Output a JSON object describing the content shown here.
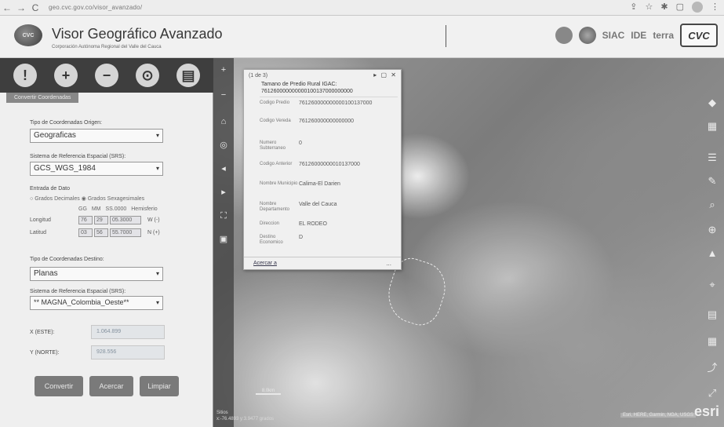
{
  "browser": {
    "back_icon": "←",
    "forward_icon": "→",
    "reload_icon": "C",
    "url": "geo.cvc.gov.co/visor_avanzado/"
  },
  "header": {
    "title": "Visor Geográfico Avanzado",
    "subtitle": "Corporación Autónoma Regional del Valle del Cauca",
    "logos": {
      "siac": "SIAC",
      "ide": "IDE",
      "terra": "terra",
      "cvc": "CVC"
    }
  },
  "toolbar": {
    "tools": [
      "info-icon",
      "plus-icon",
      "minus-icon",
      "location-pin-icon",
      "document-icon"
    ]
  },
  "panel": {
    "tab_label": "Convertir Coordenadas",
    "origin_type_label": "Tipo de Coordenadas Origen:",
    "origin_type_value": "Geograficas",
    "origin_srs_label": "Sistema de Referencia Espacial (SRS):",
    "origin_srs_value": "GCS_WGS_1984",
    "entry_label": "Entrada de Dato",
    "radio_decimal": "Grados Decimales",
    "radio_sexagesimal": "Grados Sexagesimales",
    "coord_header": "GG MM SS.0000 Hemisferio",
    "longitude": {
      "label": "Longitud",
      "gg": "76",
      "mm": "29",
      "ss": "05.3000",
      "hemisphere": "W (-)"
    },
    "latitude": {
      "label": "Latitud",
      "gg": "03",
      "mm": "56",
      "ss": "55.7000",
      "hemisphere": "N (+)"
    },
    "dest_type_label": "Tipo de Coordenadas Destino:",
    "dest_type_value": "Planas",
    "dest_srs_label": "Sistema de Referencia Espacial (SRS):",
    "dest_srs_value": "** MAGNA_Colombia_Oeste**",
    "x_label": "X (ESTE):",
    "x_value": "1.064.899",
    "y_label": "Y (NORTE):",
    "y_value": "928.556",
    "buttons": {
      "convert": "Convertir",
      "zoom": "Acercar",
      "clear": "Limpiar"
    }
  },
  "popup": {
    "pager": "(1 de 3)",
    "controls": "▸ ▢ ✕",
    "title": "Tamano de Predio Rural IGAC:",
    "title_code": "761260000000000100137000000000",
    "rows": [
      {
        "key": "Codigo Predio",
        "value": "761260000000000100137000"
      },
      {
        "key": "Codigo Vereda",
        "value": "761260000000000000"
      },
      {
        "key": "Numero Subterraneo",
        "value": "0"
      },
      {
        "key": "Codigo Anterior",
        "value": "76126000000010137000"
      },
      {
        "key": "Nombre Municipio",
        "value": "Calima-El Darien"
      },
      {
        "key": "Nombre Departamento",
        "value": "Valle del Cauca"
      },
      {
        "key": "Direccion",
        "value": "EL RODEO"
      },
      {
        "key": "Destino Economico",
        "value": "D"
      }
    ],
    "zoom_link": "Acercar a",
    "more": "..."
  },
  "map": {
    "scale_label": "8.0km",
    "caption_line1": "Sitios",
    "caption_line2": "x:-76.4893 y:3.9477 grados",
    "attribution": "Esri, HERE, Garmin, NGA, USGS",
    "esri": "esri"
  }
}
